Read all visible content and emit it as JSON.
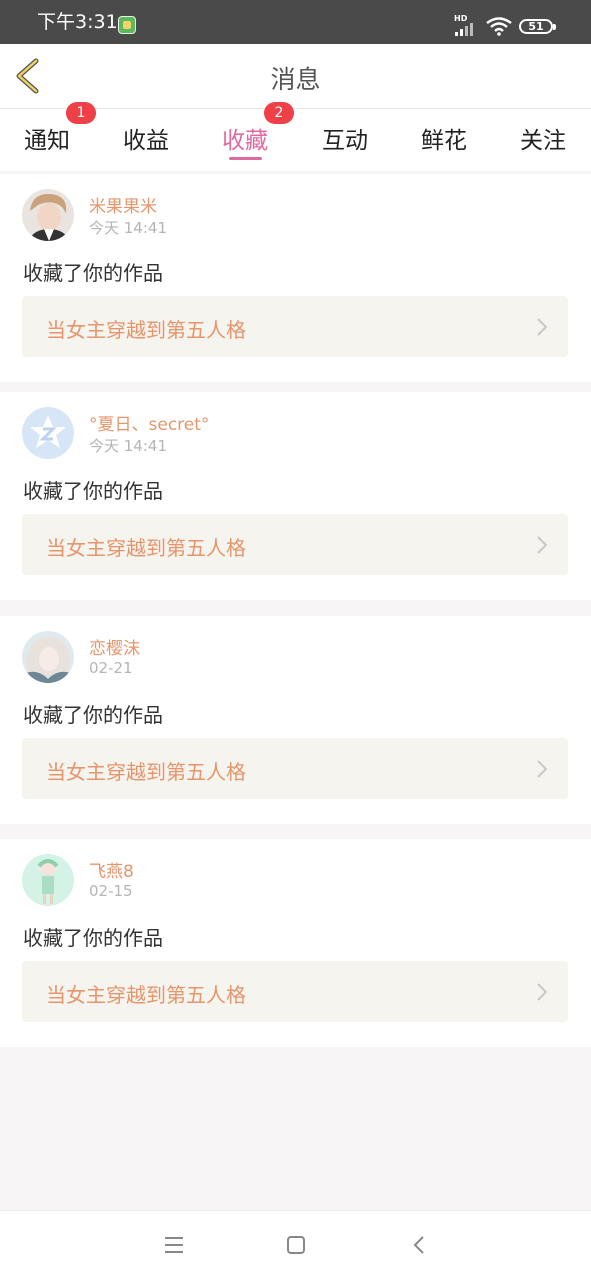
{
  "status_bar": {
    "time": "下午3:31",
    "network_label": "HD",
    "battery": "51",
    "icons": [
      "app-notification-icon",
      "signal-icon",
      "wifi-icon",
      "battery-icon"
    ]
  },
  "header": {
    "title": "消息",
    "back_icon": "chevron-left-icon"
  },
  "tabs": [
    {
      "label": "通知",
      "badge": "1"
    },
    {
      "label": "收益",
      "badge": ""
    },
    {
      "label": "收藏",
      "badge": "2",
      "active": true
    },
    {
      "label": "互动",
      "badge": ""
    },
    {
      "label": "鲜花",
      "badge": ""
    },
    {
      "label": "关注",
      "badge": ""
    }
  ],
  "notifications": [
    {
      "user": "米果果米",
      "time": "今天 14:41",
      "action": "收藏了你的作品",
      "work": "当女主穿越到第五人格"
    },
    {
      "user": "°夏日、secret°",
      "time": "今天 14:41",
      "action": "收藏了你的作品",
      "work": "当女主穿越到第五人格"
    },
    {
      "user": "恋樱沫",
      "time": "02-21",
      "action": "收藏了你的作品",
      "work": "当女主穿越到第五人格"
    },
    {
      "user": "飞燕8",
      "time": "02-15",
      "action": "收藏了你的作品",
      "work": "当女主穿越到第五人格"
    }
  ],
  "colors": {
    "accent": "#e06aa0",
    "name_orange": "#e7956b",
    "badge_red": "#ef4048",
    "status_bar": "#4a4a4a"
  },
  "bottom_nav": [
    "menu-icon",
    "home-square-icon",
    "back-icon"
  ]
}
